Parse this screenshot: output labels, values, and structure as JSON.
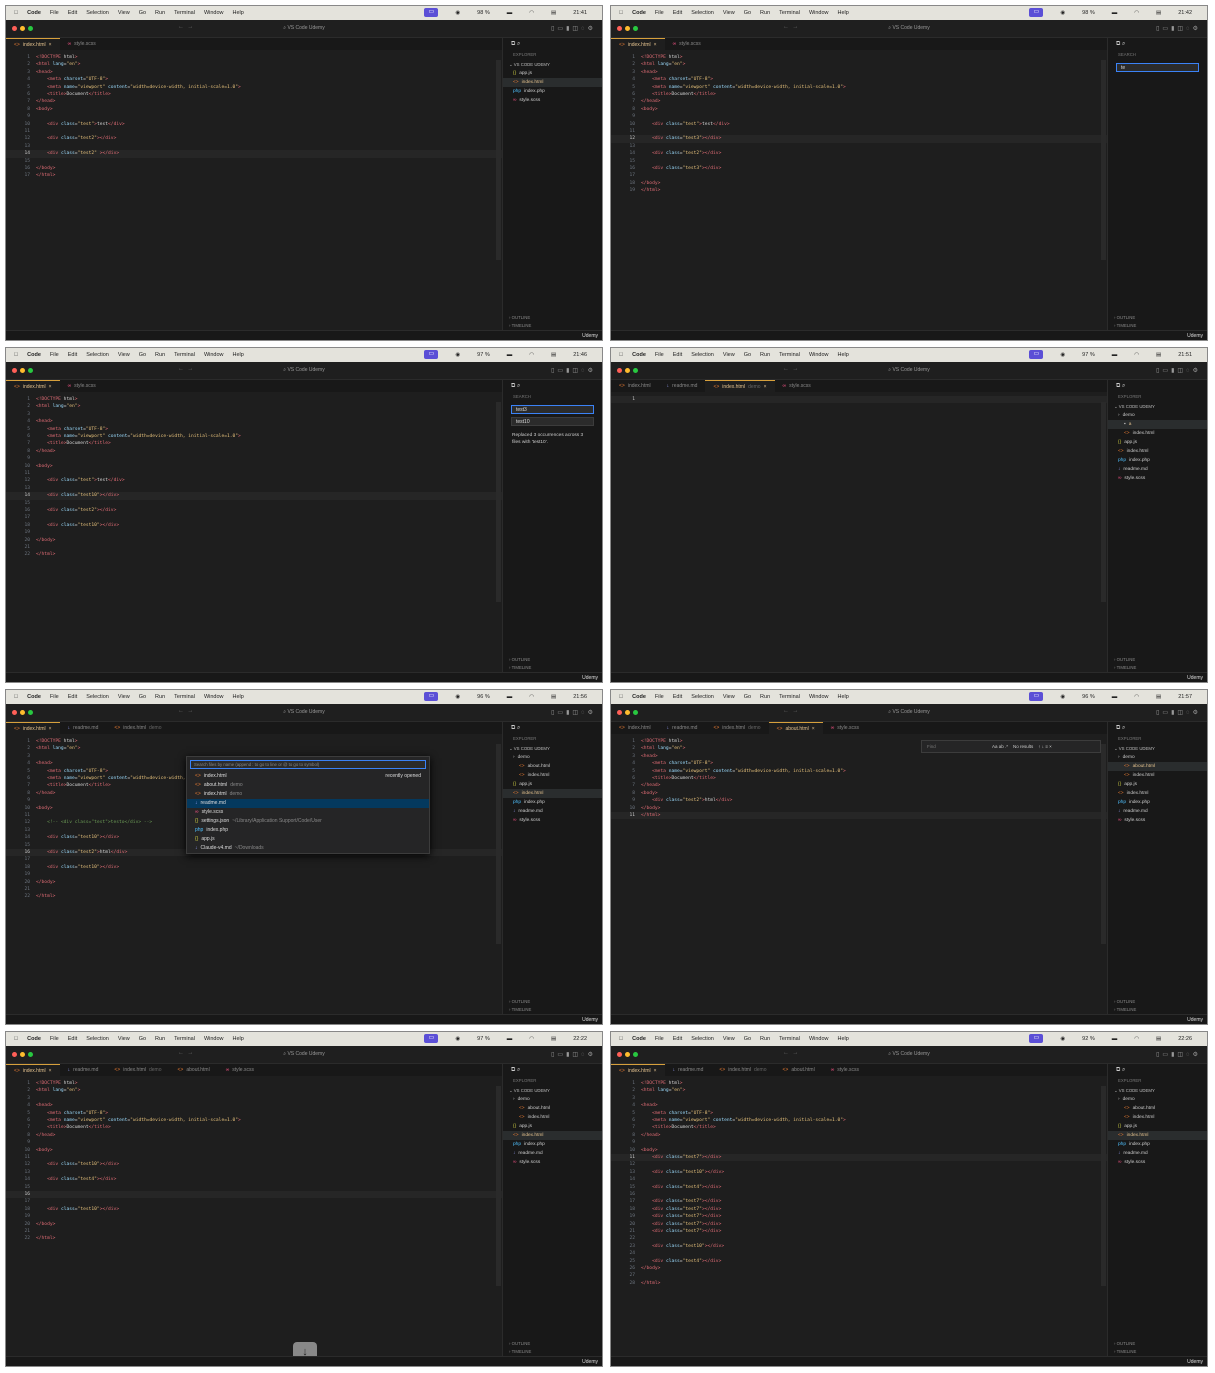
{
  "menu": {
    "app": "Code",
    "items": [
      "File",
      "Edit",
      "Selection",
      "View",
      "Go",
      "Run",
      "Terminal",
      "Window",
      "Help"
    ]
  },
  "window_title": "VS Code Udemy",
  "explorer_title": "EXPLORER",
  "search_title": "SEARCH",
  "project": "VS CODE UDEMY",
  "outline": "OUTLINE",
  "timeline": "TIMELINE",
  "watermark": "Udemy",
  "colors": {
    "accent": "#5b4fd6",
    "tag": "#e06c75",
    "attr": "#9cdcfe",
    "string": "#e5c07b"
  },
  "panels": [
    {
      "time": "21:41",
      "battery": "98 %",
      "sidebar": "explorer",
      "tabs": [
        {
          "name": "index.html",
          "icon": "html",
          "active": true,
          "close": "×"
        },
        {
          "name": "style.scss",
          "icon": "scss"
        }
      ],
      "files": [
        {
          "name": "app.js",
          "icon": "js"
        },
        {
          "name": "index.html",
          "icon": "html",
          "sel": true
        },
        {
          "name": "index.php",
          "icon": "php"
        },
        {
          "name": "style.scss",
          "icon": "scss"
        }
      ],
      "cur": 14,
      "code": [
        [
          1,
          "<!DOCTYPE html>"
        ],
        [
          2,
          "<html lang=\"en\">"
        ],
        [
          3,
          "<head>"
        ],
        [
          4,
          "    <meta charset=\"UTF-8\">"
        ],
        [
          5,
          "    <meta name=\"viewport\" content=\"width=device-width, initial-scale=1.0\">"
        ],
        [
          6,
          "    <title>Document</title>"
        ],
        [
          7,
          "</head>"
        ],
        [
          8,
          "<body>"
        ],
        [
          9,
          ""
        ],
        [
          10,
          "    <div class=\"test\">test</div>"
        ],
        [
          11,
          ""
        ],
        [
          12,
          "    <div class=\"test2\"></div>"
        ],
        [
          13,
          ""
        ],
        [
          14,
          "    <div class=\"test2\" ></div>"
        ],
        [
          15,
          ""
        ],
        [
          16,
          "</body>"
        ],
        [
          17,
          "</html>"
        ]
      ]
    },
    {
      "time": "21:42",
      "battery": "98 %",
      "sidebar": "search",
      "search": "te",
      "tabs": [
        {
          "name": "index.html",
          "icon": "html",
          "active": true,
          "close": "×"
        },
        {
          "name": "style.scss",
          "icon": "scss"
        }
      ],
      "cur": 12,
      "code": [
        [
          1,
          "<!DOCTYPE html>"
        ],
        [
          2,
          "<html lang=\"en\">"
        ],
        [
          3,
          "<head>"
        ],
        [
          4,
          "    <meta charset=\"UTF-8\">"
        ],
        [
          5,
          "    <meta name=\"viewport\" content=\"width=device-width, initial-scale=1.0\">"
        ],
        [
          6,
          "    <title>Document</title>"
        ],
        [
          7,
          "</head>"
        ],
        [
          8,
          "<body>"
        ],
        [
          9,
          ""
        ],
        [
          10,
          "    <div class=\"test\">test</div>"
        ],
        [
          11,
          ""
        ],
        [
          12,
          "    <div class=\"test3\"></div>"
        ],
        [
          13,
          ""
        ],
        [
          14,
          "    <div class=\"test2\"></div>"
        ],
        [
          15,
          ""
        ],
        [
          16,
          "    <div class=\"test3\"></div>"
        ],
        [
          17,
          ""
        ],
        [
          18,
          "</body>"
        ],
        [
          19,
          "</html>"
        ]
      ]
    },
    {
      "time": "21:46",
      "battery": "97 %",
      "sidebar": "search",
      "search": "test3",
      "replace": "test10",
      "message": "Replaced 3 occurrences across 3 files with 'test10'.",
      "tabs": [
        {
          "name": "index.html",
          "icon": "html",
          "active": true,
          "close": "×"
        },
        {
          "name": "style.scss",
          "icon": "scss"
        }
      ],
      "cur": 14,
      "code": [
        [
          1,
          "<!DOCTYPE html>"
        ],
        [
          2,
          "<html lang=\"en\">"
        ],
        [
          3,
          ""
        ],
        [
          4,
          "<head>"
        ],
        [
          5,
          "    <meta charset=\"UTF-8\">"
        ],
        [
          6,
          "    <meta name=\"viewport\" content=\"width=device-width, initial-scale=1.0\">"
        ],
        [
          7,
          "    <title>Document</title>"
        ],
        [
          8,
          "</head>"
        ],
        [
          9,
          ""
        ],
        [
          10,
          "<body>"
        ],
        [
          11,
          ""
        ],
        [
          12,
          "    <div class=\"test\">test</div>"
        ],
        [
          13,
          ""
        ],
        [
          14,
          "    <div class=\"test10\"></div>"
        ],
        [
          15,
          ""
        ],
        [
          16,
          "    <div class=\"test2\"></div>"
        ],
        [
          17,
          ""
        ],
        [
          18,
          "    <div class=\"test10\"></div>"
        ],
        [
          19,
          ""
        ],
        [
          20,
          "</body>"
        ],
        [
          21,
          ""
        ],
        [
          22,
          "</html>"
        ]
      ]
    },
    {
      "time": "21:51",
      "battery": "97 %",
      "sidebar": "explorer",
      "tabs": [
        {
          "name": "index.html",
          "icon": "html"
        },
        {
          "name": "readme.md",
          "icon": "md"
        },
        {
          "name": "index.html",
          "desc": "demo",
          "icon": "html",
          "active": true,
          "close": "×"
        },
        {
          "name": "style.scss",
          "icon": "scss"
        }
      ],
      "files": [
        {
          "name": "demo",
          "icon": "folder"
        },
        {
          "name": "a",
          "icon": "file",
          "ind": true,
          "sel": true
        },
        {
          "name": "index.html",
          "icon": "html",
          "ind": true
        },
        {
          "name": "app.js",
          "icon": "js"
        },
        {
          "name": "index.html",
          "icon": "html"
        },
        {
          "name": "index.php",
          "icon": "php"
        },
        {
          "name": "readme.md",
          "icon": "md"
        },
        {
          "name": "style.scss",
          "icon": "scss"
        }
      ],
      "cur": 1,
      "code": [
        [
          1,
          ""
        ]
      ]
    },
    {
      "time": "21:56",
      "battery": "96 %",
      "sidebar": "explorer",
      "tabs": [
        {
          "name": "index.html",
          "icon": "html",
          "active": true,
          "close": "×"
        },
        {
          "name": "readme.md",
          "icon": "md"
        },
        {
          "name": "index.html",
          "desc": "demo",
          "icon": "html"
        }
      ],
      "files": [
        {
          "name": "demo",
          "icon": "folder"
        },
        {
          "name": "about.html",
          "icon": "html",
          "ind": true
        },
        {
          "name": "index.html",
          "icon": "html",
          "ind": true
        },
        {
          "name": "app.js",
          "icon": "js"
        },
        {
          "name": "index.html",
          "icon": "html",
          "sel": true
        },
        {
          "name": "index.php",
          "icon": "php"
        },
        {
          "name": "readme.md",
          "icon": "md"
        },
        {
          "name": "style.scss",
          "icon": "scss"
        }
      ],
      "quick": {
        "placeholder": "Search files by name (append : to go to line or @ to go to symbol)",
        "recent": "recently opened",
        "items": [
          {
            "name": "index.html",
            "icon": "html"
          },
          {
            "name": "about.html",
            "desc": "demo",
            "icon": "html"
          },
          {
            "name": "index.html",
            "desc": "demo",
            "icon": "html"
          },
          {
            "name": "readme.md",
            "icon": "md",
            "sel": true
          },
          {
            "name": "style.scss",
            "icon": "scss"
          },
          {
            "name": "settings.json",
            "desc": "~/Library/Application Support/Code/User",
            "icon": "json"
          },
          {
            "name": "index.php",
            "icon": "php"
          },
          {
            "name": "app.js",
            "icon": "js"
          },
          {
            "name": "Claude-v4.md",
            "desc": "~/Downloads",
            "icon": "md"
          }
        ]
      },
      "cur": 16,
      "code": [
        [
          1,
          "<!DOCTYPE html>"
        ],
        [
          2,
          "<html lang=\"en\">"
        ],
        [
          3,
          ""
        ],
        [
          4,
          "<head>"
        ],
        [
          5,
          "    <meta charset=\"UTF-8\">"
        ],
        [
          6,
          "    <meta name=\"viewport\" content=\"width=device-width, initial-scale=1.0\">"
        ],
        [
          7,
          "    <title>Document</title>"
        ],
        [
          8,
          "</head>"
        ],
        [
          9,
          ""
        ],
        [
          10,
          "<body>"
        ],
        [
          11,
          ""
        ],
        [
          12,
          "    <!-- <div class=\"test\">testo</div> -->"
        ],
        [
          13,
          ""
        ],
        [
          14,
          "    <div class=\"test10\"></div>"
        ],
        [
          15,
          ""
        ],
        [
          16,
          "    <div class=\"test2\">html</div>"
        ],
        [
          17,
          ""
        ],
        [
          18,
          "    <div class=\"test10\"></div>"
        ],
        [
          19,
          ""
        ],
        [
          20,
          "</body>"
        ],
        [
          21,
          ""
        ],
        [
          22,
          "</html>"
        ]
      ]
    },
    {
      "time": "21:57",
      "battery": "96 %",
      "sidebar": "explorer",
      "tabs": [
        {
          "name": "index.html",
          "icon": "html"
        },
        {
          "name": "readme.md",
          "icon": "md"
        },
        {
          "name": "index.html",
          "desc": "demo",
          "icon": "html"
        },
        {
          "name": "about.html",
          "icon": "html",
          "active": true,
          "close": "×"
        },
        {
          "name": "style.scss",
          "icon": "scss"
        }
      ],
      "files": [
        {
          "name": "demo",
          "icon": "folder"
        },
        {
          "name": "about.html",
          "icon": "html",
          "ind": true,
          "sel": true
        },
        {
          "name": "index.html",
          "icon": "html",
          "ind": true
        },
        {
          "name": "app.js",
          "icon": "js"
        },
        {
          "name": "index.html",
          "icon": "html"
        },
        {
          "name": "index.php",
          "icon": "php"
        },
        {
          "name": "readme.md",
          "icon": "md"
        },
        {
          "name": "style.scss",
          "icon": "scss"
        }
      ],
      "find": {
        "placeholder": "Find",
        "options": "Aa ab .*",
        "result": "No results"
      },
      "cur": 11,
      "code": [
        [
          1,
          "<!DOCTYPE html>"
        ],
        [
          2,
          "<html lang=\"en\">"
        ],
        [
          3,
          "<head>"
        ],
        [
          4,
          "    <meta charset=\"UTF-8\">"
        ],
        [
          5,
          "    <meta name=\"viewport\" content=\"width=device-width, initial-scale=1.0\">"
        ],
        [
          6,
          "    <title>Document</title>"
        ],
        [
          7,
          "</head>"
        ],
        [
          8,
          "<body>"
        ],
        [
          9,
          "    <div class=\"test2\">html</div>"
        ],
        [
          10,
          "</body>"
        ],
        [
          11,
          "</html>"
        ]
      ]
    },
    {
      "time": "22:22",
      "battery": "97 %",
      "sidebar": "explorer",
      "down": "↓",
      "tabs": [
        {
          "name": "index.html",
          "icon": "html",
          "active": true,
          "close": "×"
        },
        {
          "name": "readme.md",
          "icon": "md"
        },
        {
          "name": "index.html",
          "desc": "demo",
          "icon": "html"
        },
        {
          "name": "about.html",
          "icon": "html"
        },
        {
          "name": "style.scss",
          "icon": "scss"
        }
      ],
      "files": [
        {
          "name": "demo",
          "icon": "folder"
        },
        {
          "name": "about.html",
          "icon": "html",
          "ind": true
        },
        {
          "name": "index.html",
          "icon": "html",
          "ind": true
        },
        {
          "name": "app.js",
          "icon": "js"
        },
        {
          "name": "index.html",
          "icon": "html",
          "sel": true
        },
        {
          "name": "index.php",
          "icon": "php"
        },
        {
          "name": "readme.md",
          "icon": "md"
        },
        {
          "name": "style.scss",
          "icon": "scss"
        }
      ],
      "cur": 16,
      "code": [
        [
          1,
          "<!DOCTYPE html>"
        ],
        [
          2,
          "<html lang=\"en\">"
        ],
        [
          3,
          ""
        ],
        [
          4,
          "<head>"
        ],
        [
          5,
          "    <meta charset=\"UTF-8\">"
        ],
        [
          6,
          "    <meta name=\"viewport\" content=\"width=device-width, initial-scale=1.0\">"
        ],
        [
          7,
          "    <title>Document</title>"
        ],
        [
          8,
          "</head>"
        ],
        [
          9,
          ""
        ],
        [
          10,
          "<body>"
        ],
        [
          11,
          ""
        ],
        [
          12,
          "    <div class=\"test10\"></div>"
        ],
        [
          13,
          ""
        ],
        [
          14,
          "    <div class=\"test4\"></div>"
        ],
        [
          15,
          ""
        ],
        [
          16,
          ""
        ],
        [
          17,
          ""
        ],
        [
          18,
          "    <div class=\"test10\"></div>"
        ],
        [
          19,
          ""
        ],
        [
          20,
          "</body>"
        ],
        [
          21,
          ""
        ],
        [
          22,
          "</html>"
        ]
      ]
    },
    {
      "time": "22:26",
      "battery": "92 %",
      "sidebar": "explorer",
      "tabs": [
        {
          "name": "index.html",
          "icon": "html",
          "active": true,
          "close": "×"
        },
        {
          "name": "readme.md",
          "icon": "md"
        },
        {
          "name": "index.html",
          "desc": "demo",
          "icon": "html"
        },
        {
          "name": "about.html",
          "icon": "html"
        },
        {
          "name": "style.scss",
          "icon": "scss"
        }
      ],
      "files": [
        {
          "name": "demo",
          "icon": "folder"
        },
        {
          "name": "about.html",
          "icon": "html",
          "ind": true
        },
        {
          "name": "index.html",
          "icon": "html",
          "ind": true
        },
        {
          "name": "app.js",
          "icon": "js"
        },
        {
          "name": "index.html",
          "icon": "html",
          "sel": true
        },
        {
          "name": "index.php",
          "icon": "php"
        },
        {
          "name": "readme.md",
          "icon": "md"
        },
        {
          "name": "style.scss",
          "icon": "scss"
        }
      ],
      "cur": 11,
      "code": [
        [
          1,
          "<!DOCTYPE html>"
        ],
        [
          2,
          "<html lang=\"en\">"
        ],
        [
          3,
          ""
        ],
        [
          4,
          "<head>"
        ],
        [
          5,
          "    <meta charset=\"UTF-8\">"
        ],
        [
          6,
          "    <meta name=\"viewport\" content=\"width=device-width, initial-scale=1.0\">"
        ],
        [
          7,
          "    <title>Document</title>"
        ],
        [
          8,
          "</head>"
        ],
        [
          9,
          ""
        ],
        [
          10,
          "<body>"
        ],
        [
          11,
          "    <div class=\"test7\"></div>"
        ],
        [
          12,
          ""
        ],
        [
          13,
          "    <div class=\"test10\"></div>"
        ],
        [
          14,
          ""
        ],
        [
          15,
          "    <div class=\"test4\"></div>"
        ],
        [
          16,
          ""
        ],
        [
          17,
          "    <div class=\"test7\"></div>"
        ],
        [
          18,
          "    <div class=\"test7\"></div>"
        ],
        [
          19,
          "    <div class=\"test7\"></div>"
        ],
        [
          20,
          "    <div class=\"test7\"></div>"
        ],
        [
          21,
          "    <div class=\"test7\"></div>"
        ],
        [
          22,
          ""
        ],
        [
          23,
          "    <div class=\"test10\"></div>"
        ],
        [
          24,
          ""
        ],
        [
          25,
          "    <div class=\"test4\"></div>"
        ],
        [
          26,
          "</body>"
        ],
        [
          27,
          ""
        ],
        [
          28,
          "</html>"
        ]
      ]
    }
  ]
}
